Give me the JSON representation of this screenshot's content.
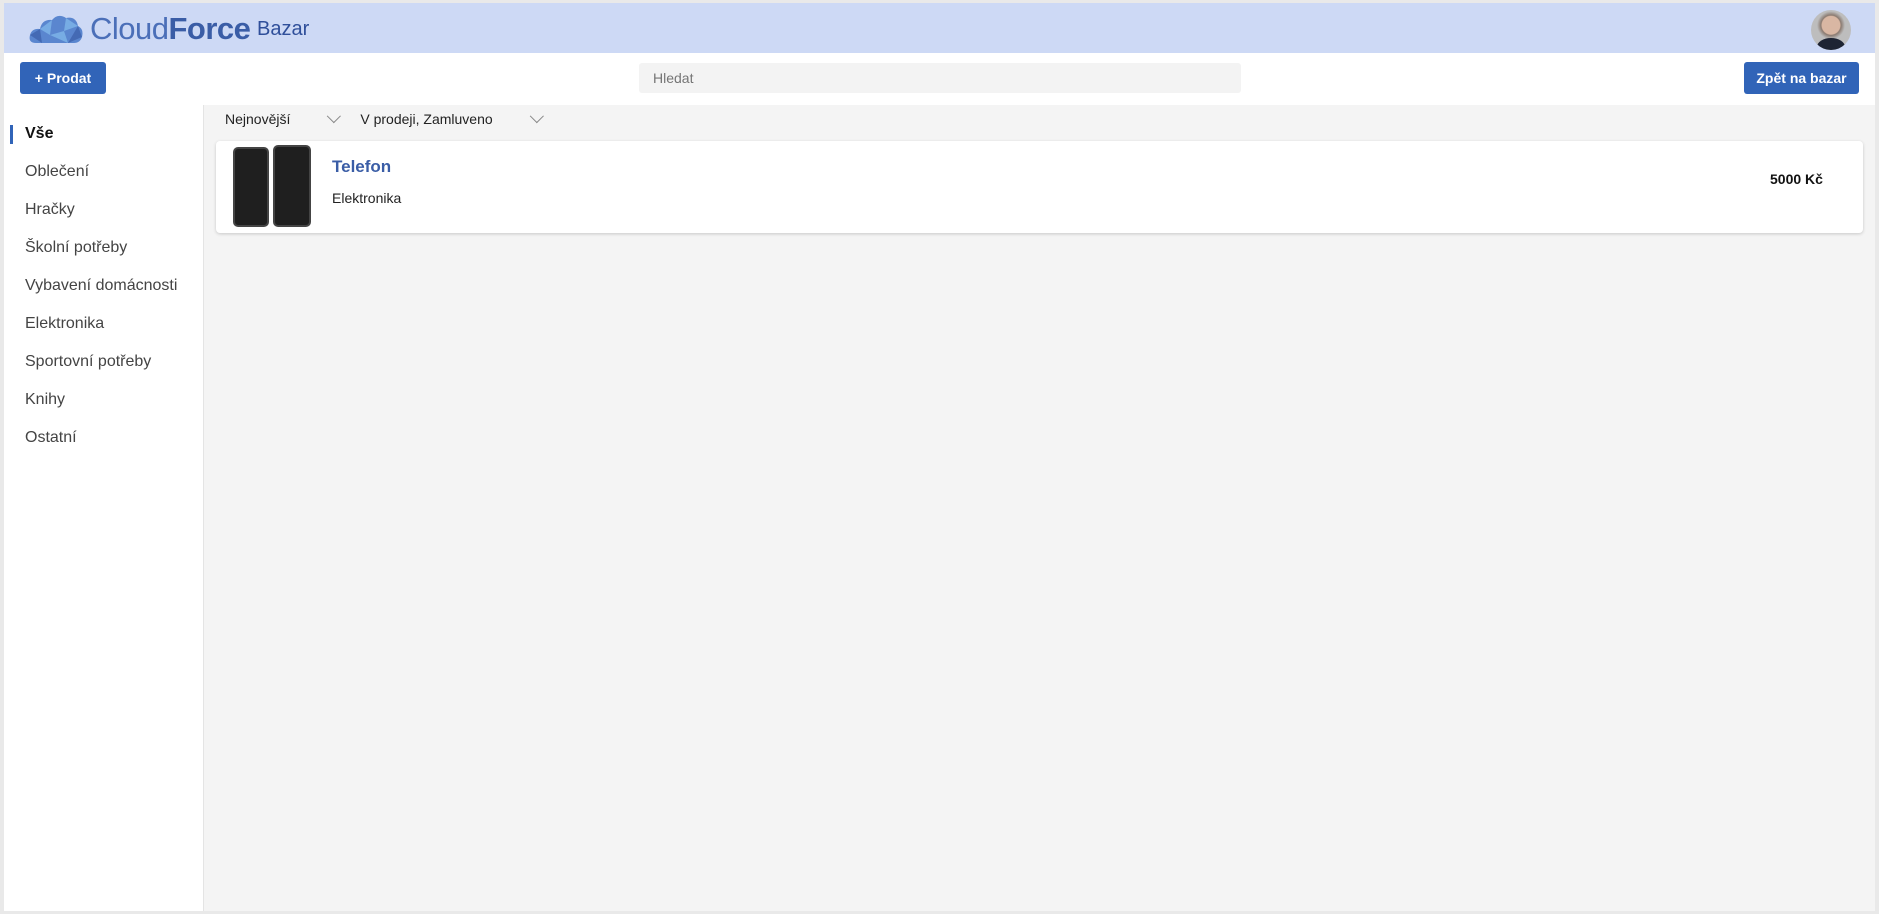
{
  "header": {
    "logo_text_light": "Cloud",
    "logo_text_bold": "Force",
    "app_title": "Bazar"
  },
  "toolbar": {
    "sell_label": "+ Prodat",
    "search_placeholder": "Hledat",
    "back_label": "Zpět na bazar"
  },
  "sidebar": {
    "items": [
      {
        "label": "Vše",
        "active": true
      },
      {
        "label": "Oblečení"
      },
      {
        "label": "Hračky"
      },
      {
        "label": "Školní potřeby"
      },
      {
        "label": "Vybavení domácnosti"
      },
      {
        "label": "Elektronika"
      },
      {
        "label": "Sportovní potřeby"
      },
      {
        "label": "Knihy"
      },
      {
        "label": "Ostatní"
      }
    ]
  },
  "filters": {
    "sort": "Nejnovější",
    "status": "V prodeji, Zamluveno"
  },
  "listings": [
    {
      "title": "Telefon",
      "category": "Elektronika",
      "price": "5000 Kč"
    }
  ],
  "colors": {
    "accent": "#3164b8",
    "header_bg": "#cdd9f5"
  }
}
